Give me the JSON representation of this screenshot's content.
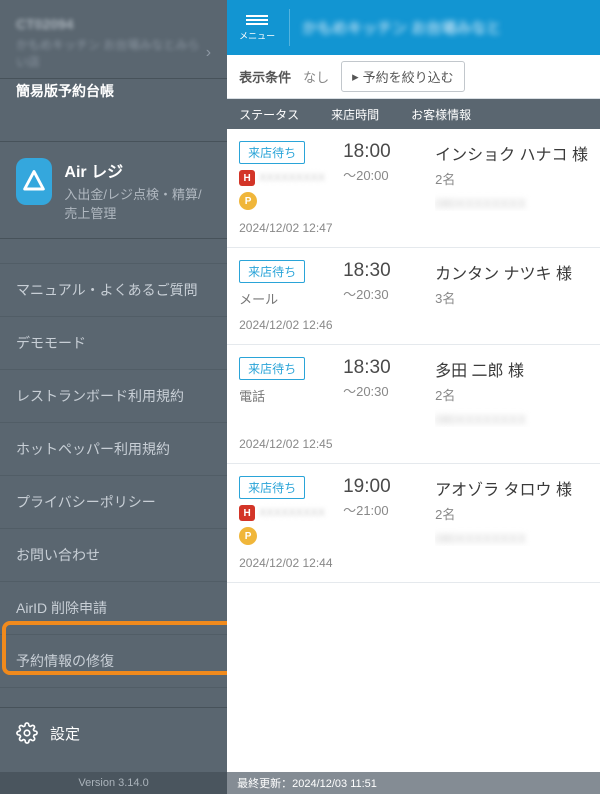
{
  "sidebar": {
    "store_id": "CT02094",
    "store_name": "かもめキッチン お台場みなとみらい店",
    "section_title": "簡易版予約台帳",
    "app": {
      "title": "Air レジ",
      "subtitle": "入出金/レジ点検・精算/売上管理"
    },
    "items": [
      "マニュアル・よくあるご質問",
      "デモモード",
      "レストランボード利用規約",
      "ホットペッパー利用規約",
      "プライバシーポリシー",
      "お問い合わせ",
      "AirID 削除申請",
      "予約情報の修復"
    ],
    "settings_label": "設定",
    "version": "Version 3.14.0"
  },
  "content": {
    "menu_label": "メニュー",
    "shop_name": "かもめキッチン お台場みなと",
    "filter_label": "表示条件",
    "filter_none": "なし",
    "filter_button": "予約を絞り込む",
    "columns": {
      "status": "ステータス",
      "time": "来店時間",
      "customer": "お客様情報"
    },
    "reservations": [
      {
        "status": "来店待ち",
        "source_type": "hotpepper",
        "source_text": "XXXXXXXXX",
        "has_p": true,
        "time": "18:00",
        "end": "～20:00",
        "name": "インショク ハナコ 様",
        "count": "2名",
        "phone": "080XXXXXXXX",
        "timestamp": "2024/12/02 12:47"
      },
      {
        "status": "来店待ち",
        "source_type": "plain",
        "source_text": "メール",
        "has_p": false,
        "time": "18:30",
        "end": "～20:30",
        "name": "カンタン ナツキ 様",
        "count": "3名",
        "phone": "",
        "timestamp": "2024/12/02 12:46"
      },
      {
        "status": "来店待ち",
        "source_type": "plain",
        "source_text": "電話",
        "has_p": false,
        "time": "18:30",
        "end": "～20:30",
        "name": "多田 二郎 様",
        "count": "2名",
        "phone": "080XXXXXXXX",
        "timestamp": "2024/12/02 12:45"
      },
      {
        "status": "来店待ち",
        "source_type": "hotpepper",
        "source_text": "XXXXXXXXX",
        "has_p": true,
        "time": "19:00",
        "end": "～21:00",
        "name": "アオゾラ タロウ 様",
        "count": "2名",
        "phone": "080XXXXXXXX",
        "timestamp": "2024/12/02 12:44"
      }
    ],
    "last_update": "最終更新：2024/12/03 11:51"
  }
}
